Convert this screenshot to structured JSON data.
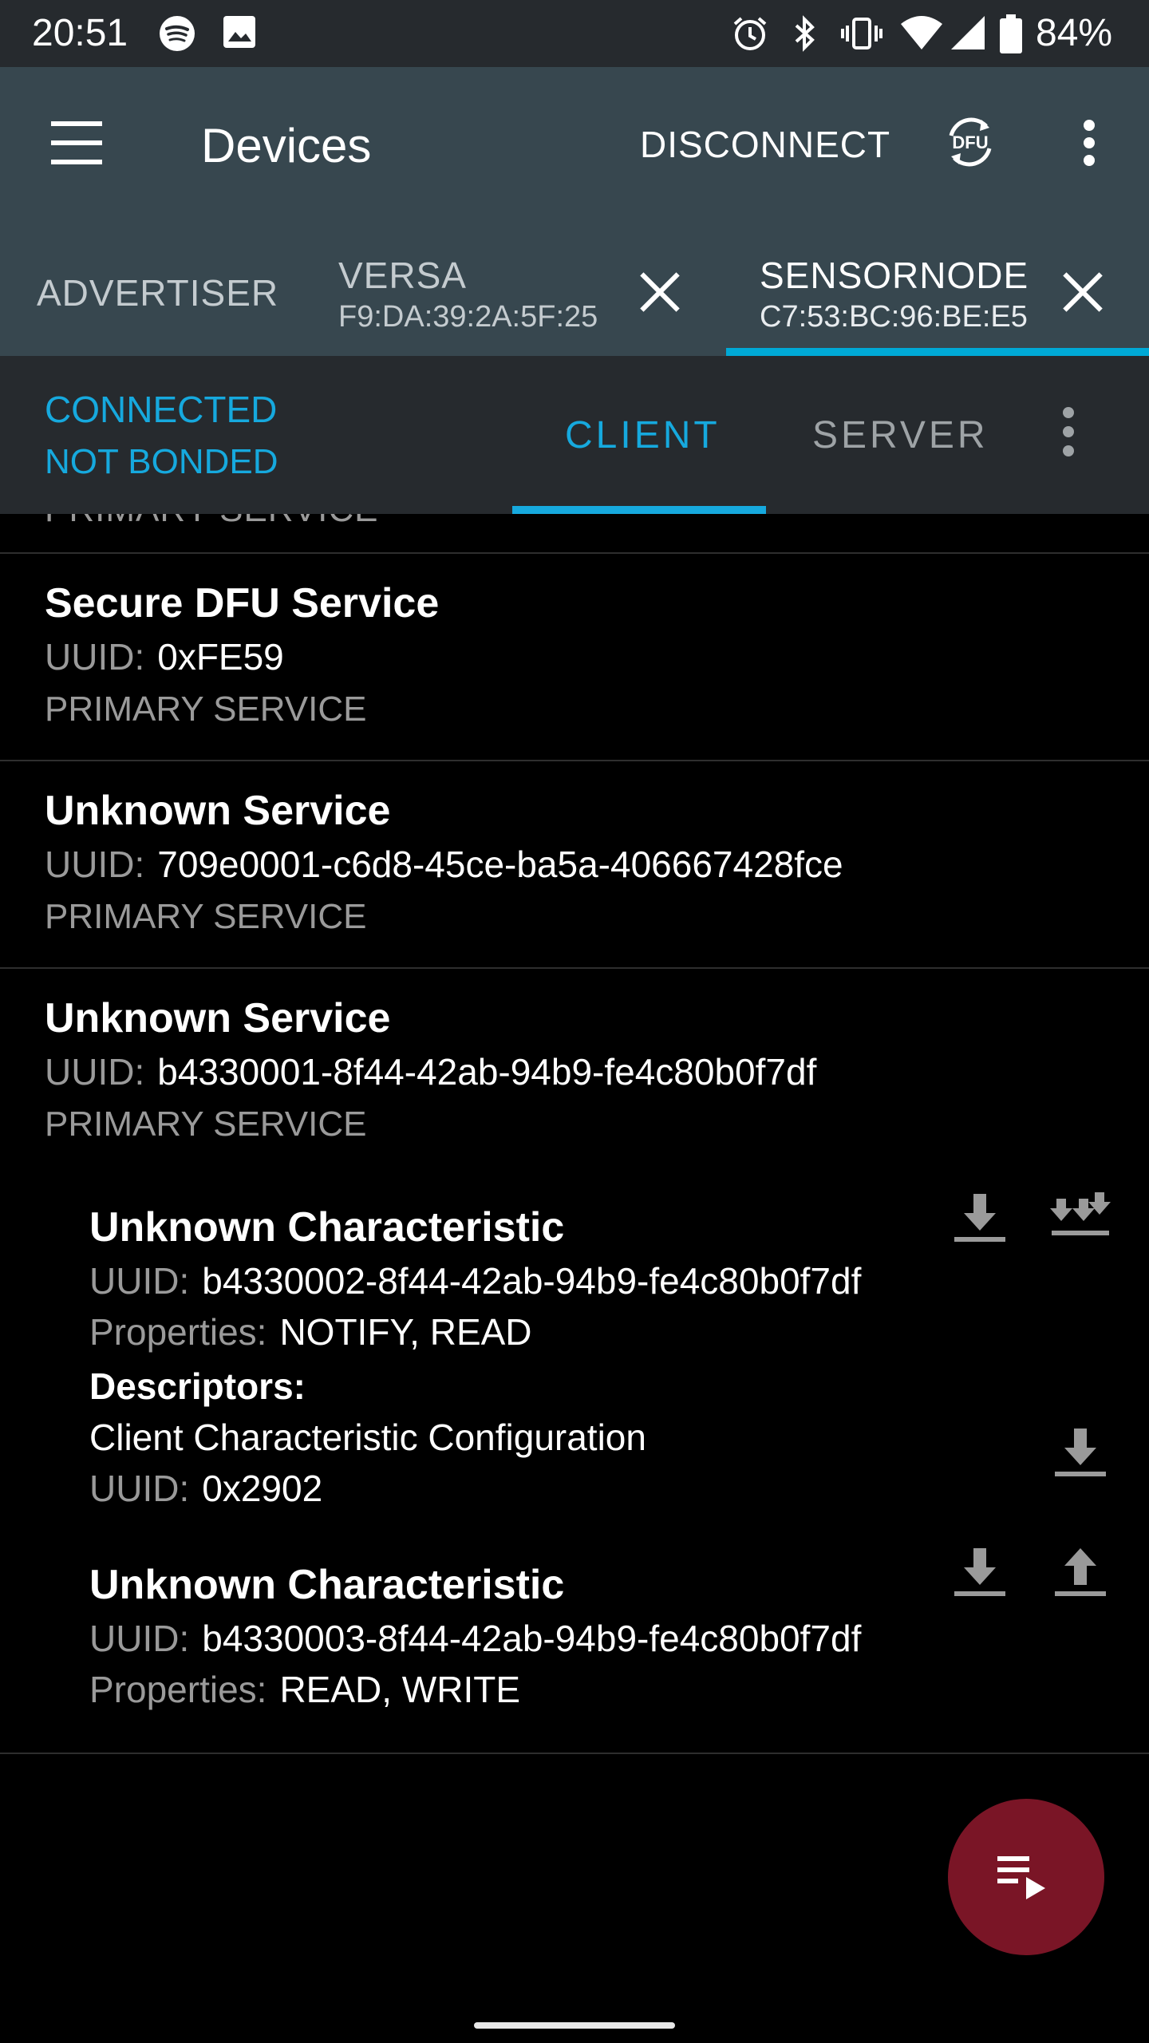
{
  "status_bar": {
    "time": "20:51",
    "battery": "84%",
    "icons": [
      "spotify-icon",
      "image-icon",
      "alarm-icon",
      "bluetooth-icon",
      "vibrate-icon",
      "wifi-icon",
      "signal-icon",
      "battery-icon"
    ]
  },
  "app_bar": {
    "title": "Devices",
    "disconnect_label": "DISCONNECT",
    "dfu_label": "DFU"
  },
  "device_tabs": {
    "advertiser_label": "ADVERTISER",
    "devices": [
      {
        "name": "VERSA",
        "address": "F9:DA:39:2A:5F:25"
      },
      {
        "name": "SENSORNODE",
        "address": "C7:53:BC:96:BE:E5"
      }
    ],
    "active_index": 1
  },
  "connection": {
    "status": "CONNECTED",
    "bond": "NOT BONDED",
    "tabs": {
      "client": "CLIENT",
      "server": "SERVER"
    },
    "active_tab": "client"
  },
  "content": {
    "clipped_label": "PRIMARY SERVICE",
    "uuid_label": "UUID:",
    "properties_label": "Properties:",
    "descriptors_label": "Descriptors:",
    "services": [
      {
        "name": "Secure DFU Service",
        "uuid": "0xFE59",
        "type": "PRIMARY SERVICE"
      },
      {
        "name": "Unknown Service",
        "uuid": "709e0001-c6d8-45ce-ba5a-406667428fce",
        "type": "PRIMARY SERVICE"
      },
      {
        "name": "Unknown Service",
        "uuid": "b4330001-8f44-42ab-94b9-fe4c80b0f7df",
        "type": "PRIMARY SERVICE"
      }
    ],
    "characteristics": [
      {
        "name": "Unknown Characteristic",
        "uuid": "b4330002-8f44-42ab-94b9-fe4c80b0f7df",
        "properties": "NOTIFY, READ",
        "descriptor": {
          "name": "Client Characteristic Configuration",
          "uuid": "0x2902"
        }
      },
      {
        "name": "Unknown Characteristic",
        "uuid": "b4330003-8f44-42ab-94b9-fe4c80b0f7df",
        "properties": "READ, WRITE"
      }
    ]
  },
  "colors": {
    "app_bar": "#37474f",
    "accent": "#16a9de",
    "fab": "#7a1526",
    "status_bar": "#262a2e"
  }
}
